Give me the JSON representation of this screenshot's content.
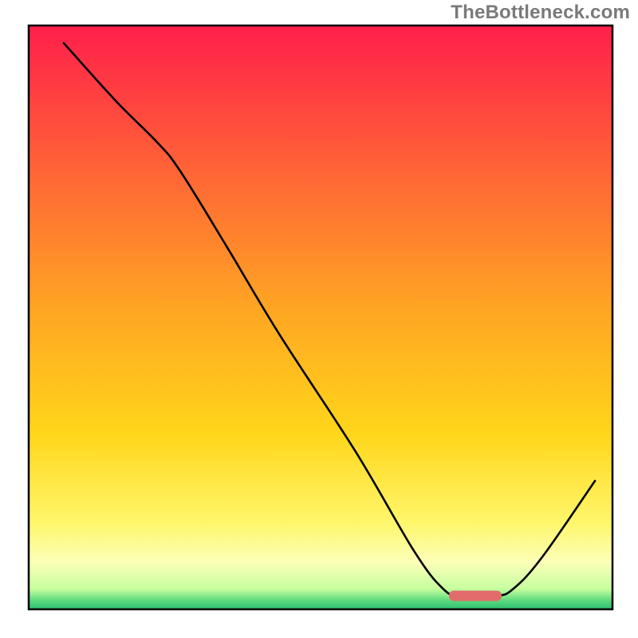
{
  "watermark": "TheBottleneck.com",
  "chart_data": {
    "type": "line",
    "title": "",
    "xlabel": "",
    "ylabel": "",
    "xlim": [
      0,
      100
    ],
    "ylim": [
      0,
      100
    ],
    "grid": false,
    "legend_position": "none",
    "curve": [
      {
        "x": 6,
        "y": 97
      },
      {
        "x": 15,
        "y": 87
      },
      {
        "x": 22,
        "y": 80
      },
      {
        "x": 26,
        "y": 75
      },
      {
        "x": 34,
        "y": 62
      },
      {
        "x": 43,
        "y": 47
      },
      {
        "x": 56,
        "y": 27
      },
      {
        "x": 66,
        "y": 10
      },
      {
        "x": 71,
        "y": 3.5
      },
      {
        "x": 74,
        "y": 2.3
      },
      {
        "x": 80,
        "y": 2.3
      },
      {
        "x": 83,
        "y": 3.5
      },
      {
        "x": 88,
        "y": 9
      },
      {
        "x": 97,
        "y": 22
      }
    ],
    "optimal_marker": {
      "x_start": 72,
      "x_end": 81,
      "y": 2.3
    },
    "gradient_stops": [
      {
        "pos": 0.0,
        "color": "#ff1f4b"
      },
      {
        "pos": 0.48,
        "color": "#ffa423"
      },
      {
        "pos": 0.7,
        "color": "#ffd61a"
      },
      {
        "pos": 0.85,
        "color": "#fff66a"
      },
      {
        "pos": 0.92,
        "color": "#fbffb7"
      },
      {
        "pos": 0.965,
        "color": "#c7ff9f"
      },
      {
        "pos": 0.985,
        "color": "#5dd97d"
      },
      {
        "pos": 1.0,
        "color": "#2abf71"
      }
    ],
    "marker_color": "#e26b6b",
    "border_color": "#000000",
    "curve_color": "#000000"
  }
}
